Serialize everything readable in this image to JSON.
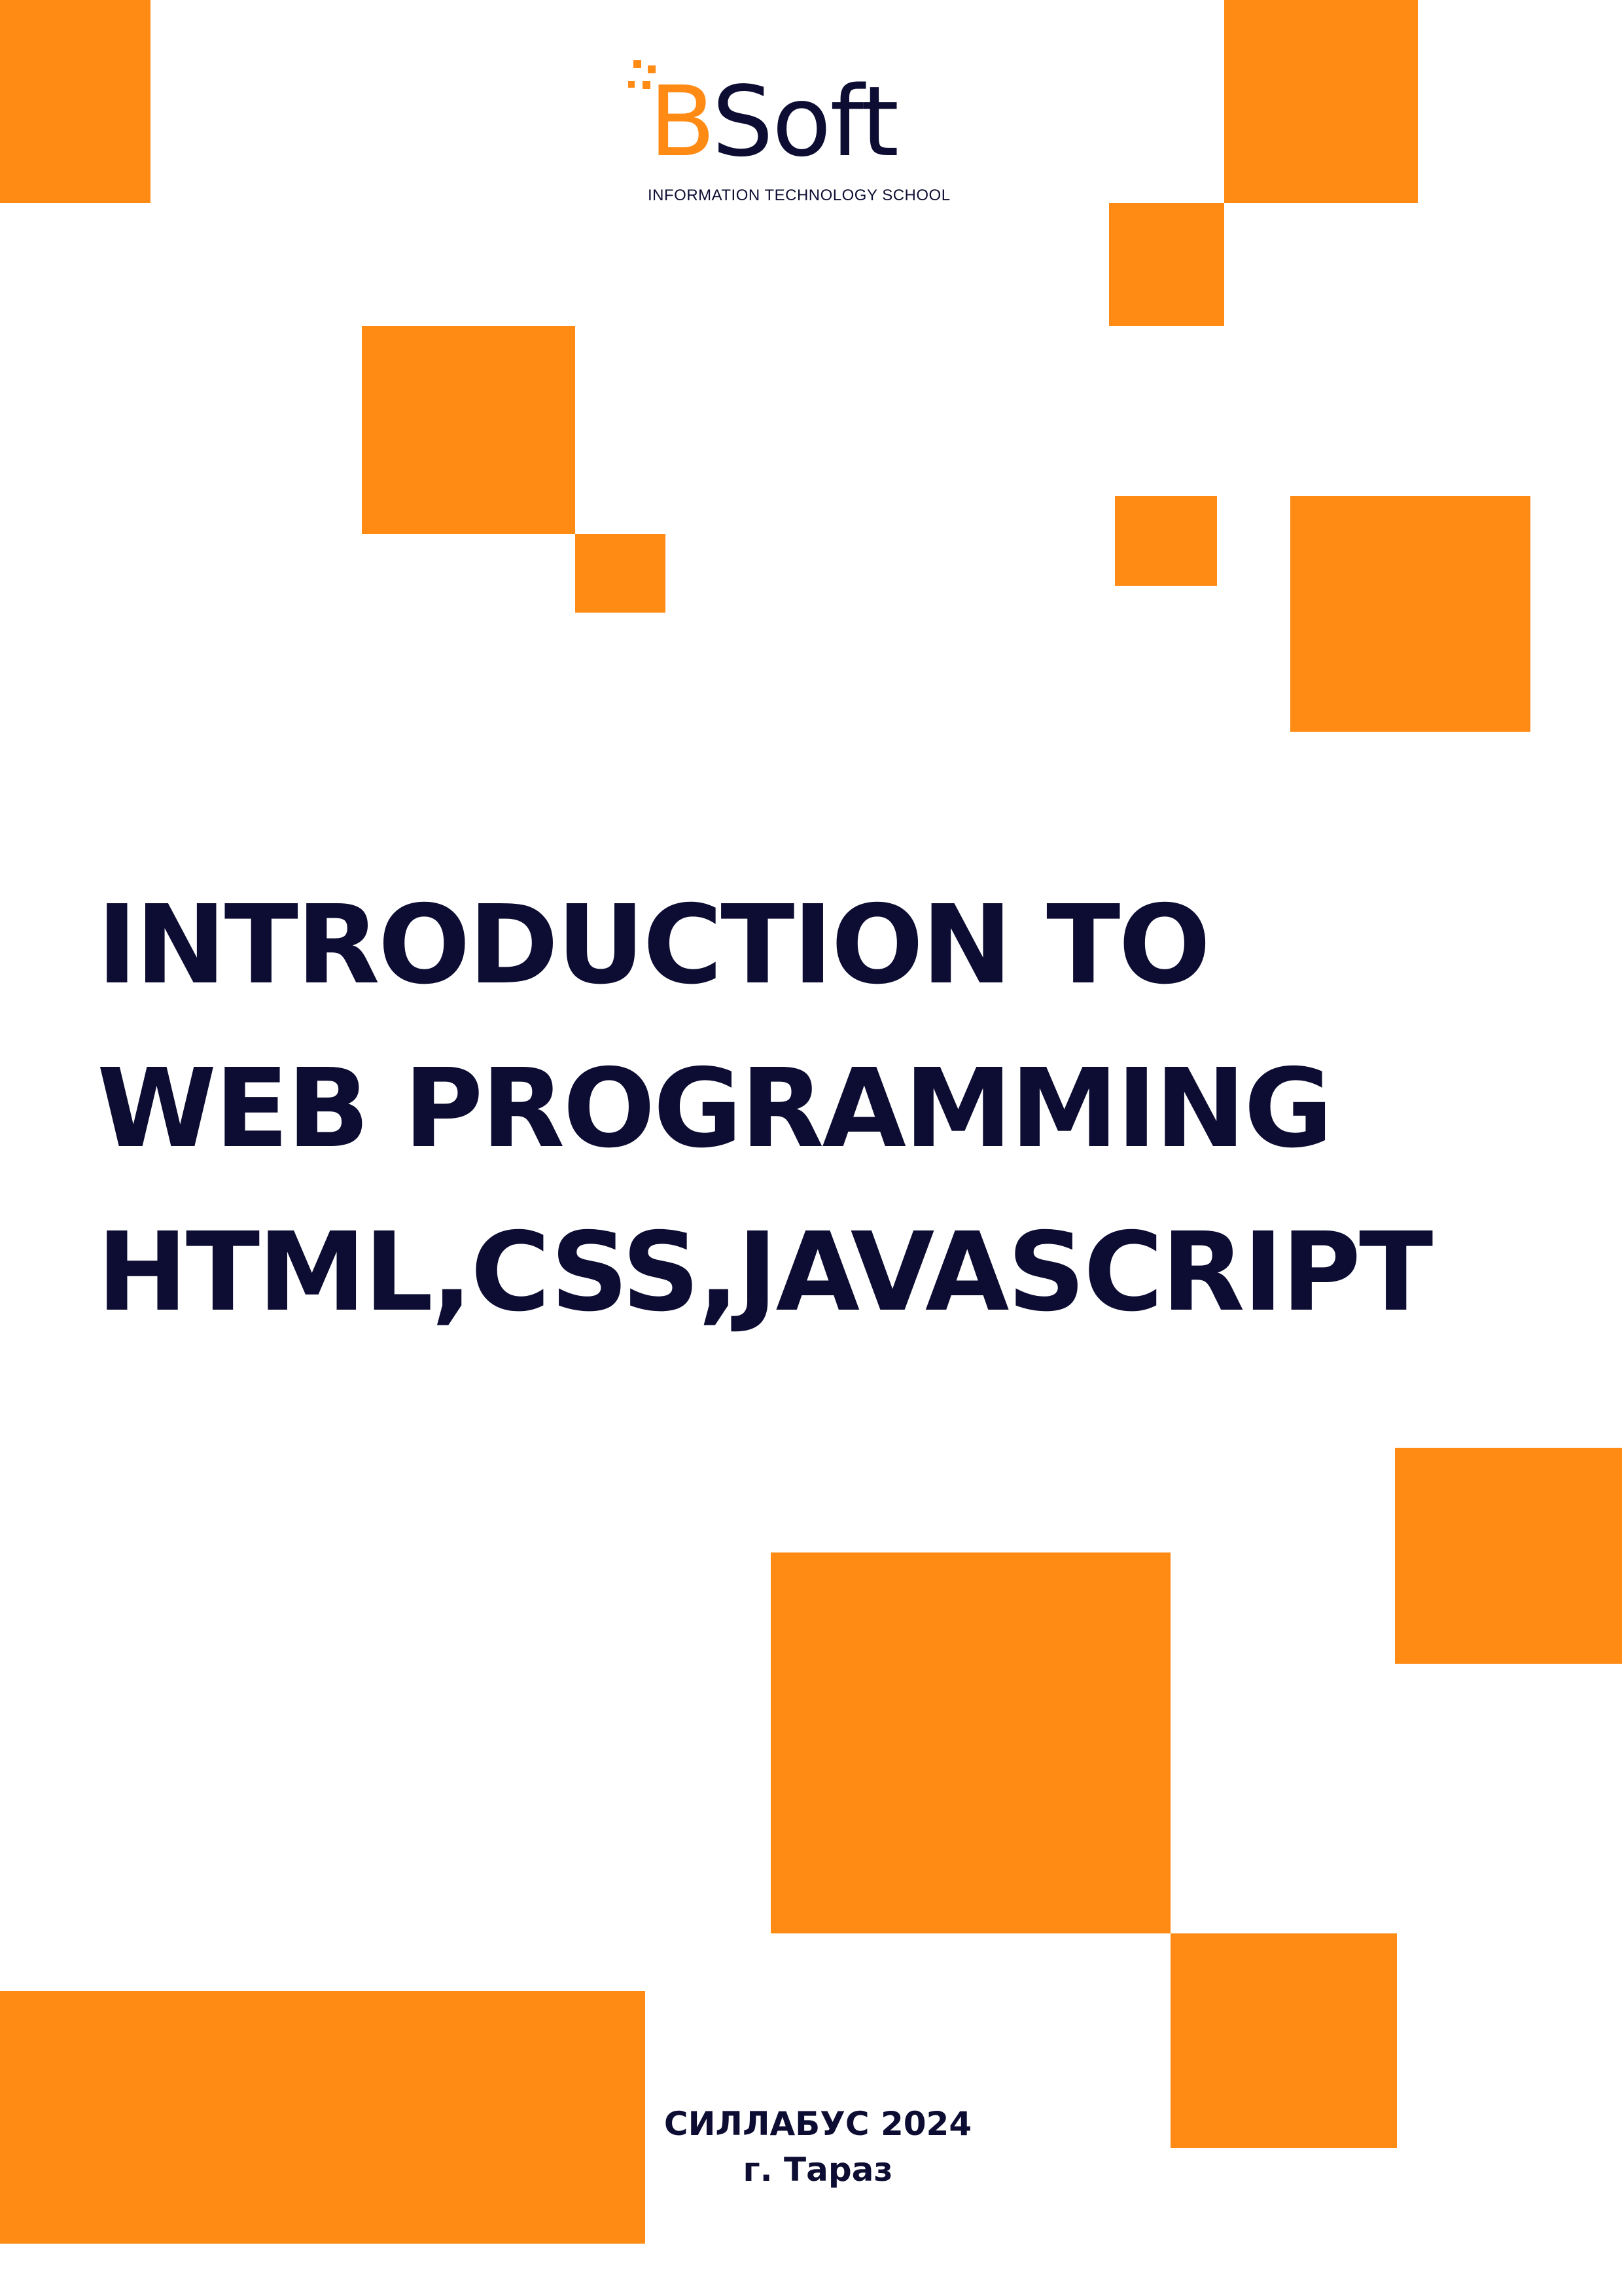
{
  "colors": {
    "accent": "#FF8A14",
    "navy": "#0D0D33",
    "background": "#FFFFFF"
  },
  "logo": {
    "letter": "B",
    "text": "Soft",
    "tagline": "INFORMATION TECHNOLOGY SCHOOL"
  },
  "title": {
    "line1": "INTRODUCTION TO",
    "line2": "WEB PROGRAMMING",
    "line3": "HTML,CSS,JAVASCRIPT"
  },
  "footer": {
    "line1": "СИЛЛАБУС 2024",
    "line2": "г. Тараз"
  }
}
